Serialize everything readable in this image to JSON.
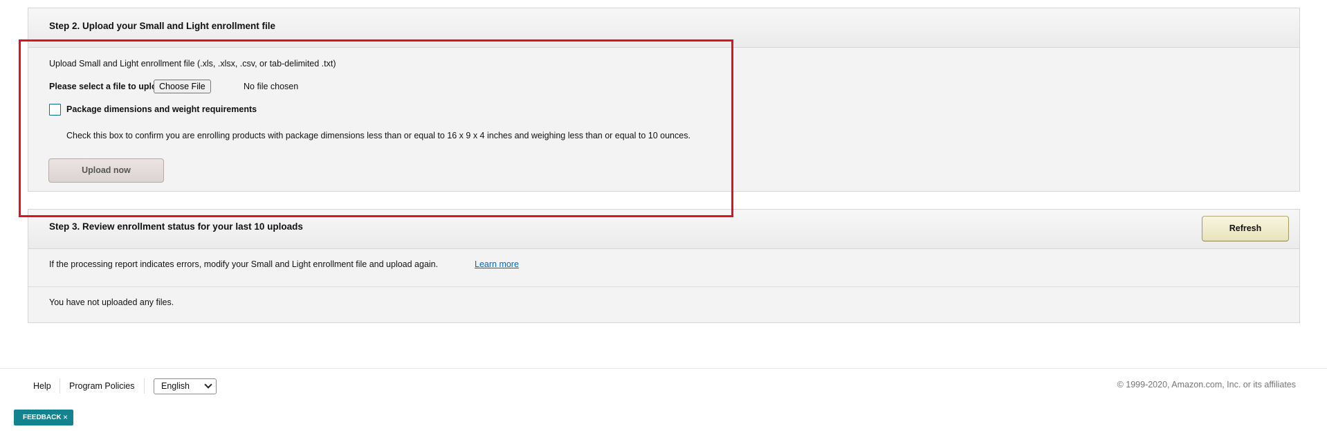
{
  "step2": {
    "title": "Step 2. Upload your Small and Light enrollment file",
    "upload_description": "Upload Small and Light enrollment file (.xls, .xlsx, .csv, or tab-delimited .txt)",
    "select_file_label": "Please select a file to upload.",
    "choose_file_button": "Choose File",
    "no_file_text": "No file chosen",
    "checkbox_label": "Package dimensions and weight requirements",
    "checkbox_checked": false,
    "checkbox_help": "Check this box to confirm you are enrolling products with package dimensions less than or equal to 16 x 9 x 4 inches and weighing less than or equal to 10 ounces.",
    "upload_button": "Upload now"
  },
  "step3": {
    "title": "Step 3. Review enrollment status for your last 10 uploads",
    "refresh_button": "Refresh",
    "info_text": "If the processing report indicates errors, modify your Small and Light enrollment file and upload again.",
    "learn_more_link": "Learn more",
    "empty_text": "You have not uploaded any files."
  },
  "footer": {
    "help_link": "Help",
    "policies_link": "Program Policies",
    "language_selected": "English",
    "copyright": "© 1999-2020, Amazon.com, Inc. or its affiliates"
  },
  "feedback": {
    "label": "FEEDBACK",
    "close_icon": "×"
  },
  "colors": {
    "highlight_border": "#e0121f",
    "link": "#0066c0",
    "feedback_bg": "#13848f",
    "checkbox_border": "#0b7285"
  }
}
